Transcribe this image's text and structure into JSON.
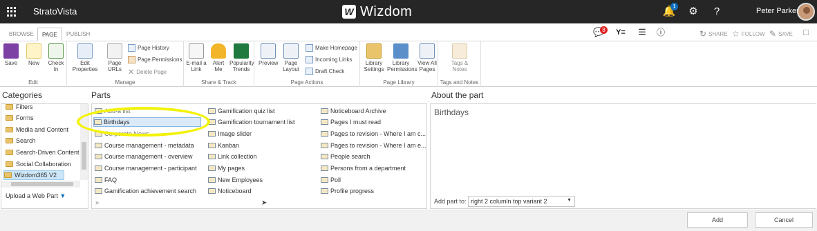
{
  "app": {
    "name": "StratoVista",
    "logo_text": "Wizdom",
    "logo_mark": "W"
  },
  "user": {
    "name": "Peter Parker"
  },
  "notifications": {
    "count": "1"
  },
  "ribbon_tabs": [
    "BROWSE",
    "PAGE",
    "PUBLISH"
  ],
  "ribbon_actions": {
    "share": "SHARE",
    "follow": "FOLLOW",
    "save": "SAVE",
    "comments_count": "8",
    "ye": "Y≡"
  },
  "ribbon": {
    "edit": {
      "label": "Edit",
      "save": "Save",
      "new": "New",
      "checkin": "Check In"
    },
    "manage": {
      "label": "Manage",
      "edit_props": "Edit Properties",
      "page_urls": "Page URLs",
      "history": "Page History",
      "permissions": "Page Permissions",
      "delete": "Delete Page"
    },
    "share": {
      "label": "Share & Track",
      "email": "E-mail a Link",
      "alert": "Alert Me",
      "popularity": "Popularity Trends"
    },
    "actions": {
      "label": "Page Actions",
      "preview": "Preview",
      "layout": "Page Layout",
      "homepage": "Make Homepage",
      "incoming": "Incoming Links",
      "draft": "Draft Check"
    },
    "library": {
      "label": "Page Library",
      "settings": "Library Settings",
      "permissions": "Library Permissions",
      "viewall": "View All Pages"
    },
    "tags": {
      "label": "Tags and Notes",
      "tags": "Tags & Notes"
    }
  },
  "sections": {
    "categories": "Categories",
    "parts": "Parts",
    "about": "About the part"
  },
  "categories": [
    "Filters",
    "Forms",
    "Media and Content",
    "Search",
    "Search-Driven Content",
    "Social Collaboration",
    "Wizdom365 V2"
  ],
  "upload": "Upload a Web Part",
  "parts": {
    "col1": [
      "Add-a list",
      "Birthdays",
      "Corporate News",
      "Course management - metadata",
      "Course management - overview",
      "Course management - participant",
      "FAQ",
      "Gamification achievement search"
    ],
    "col2": [
      "Gamification quiz list",
      "Gamification tournament list",
      "Image slider",
      "Kanban",
      "Link collection",
      "My pages",
      "New Employees",
      "Noticeboard"
    ],
    "col3": [
      "Noticeboard Archive",
      "Pages I must read",
      "Pages to revision - Where I am c...",
      "Pages to revision - Where I am e...",
      "People search",
      "Persons from a department",
      "Poll",
      "Profile progress"
    ]
  },
  "about": {
    "part_name": "Birthdays",
    "add_to_label": "Add part to:",
    "zone": "right 2 columln top variant 2"
  },
  "buttons": {
    "add": "Add",
    "cancel": "Cancel"
  }
}
